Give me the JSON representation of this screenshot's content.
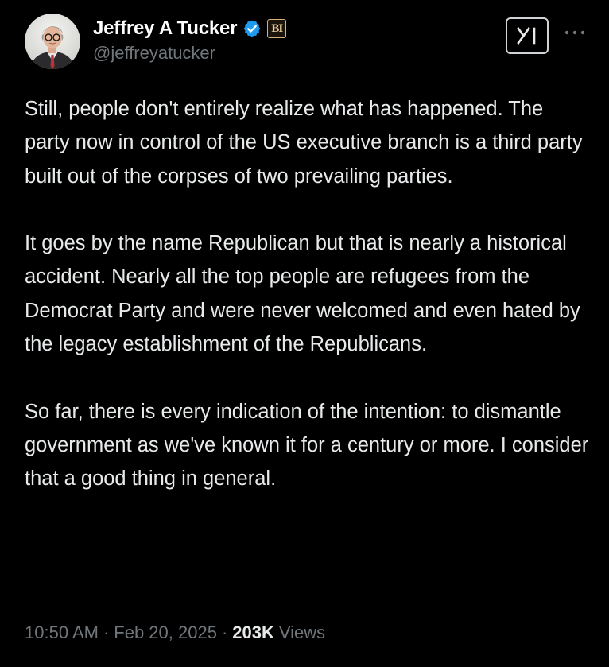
{
  "author": {
    "display_name": "Jeffrey A Tucker",
    "handle": "@jeffreyatucker",
    "affiliation_badge": "BI",
    "verified_color": "#1d9bf0",
    "avatar_icon": "person-avatar"
  },
  "header": {
    "grok_icon": "grok-icon",
    "more_icon": "more-icon"
  },
  "tweet": {
    "paragraphs": [
      "Still, people don't entirely realize what has happened. The party now in control of the US executive branch is a third party built out of the corpses of two prevailing parties.",
      "It goes by the name Republican but that is nearly a historical accident. Nearly all the top people are refugees from the Democrat Party and were never welcomed and even hated by the legacy establishment of the Republicans.",
      "So far, there is every indication of the intention: to dismantle government as we've known it for a century or more. I consider that a good thing in general."
    ],
    "time": "10:50 AM",
    "separator": "·",
    "date": "Feb 20, 2025",
    "views_count": "203K",
    "views_label": "Views"
  },
  "colors": {
    "background": "#000000",
    "text_primary": "#e7e9ea",
    "text_secondary": "#71767b",
    "verified": "#1d9bf0"
  }
}
